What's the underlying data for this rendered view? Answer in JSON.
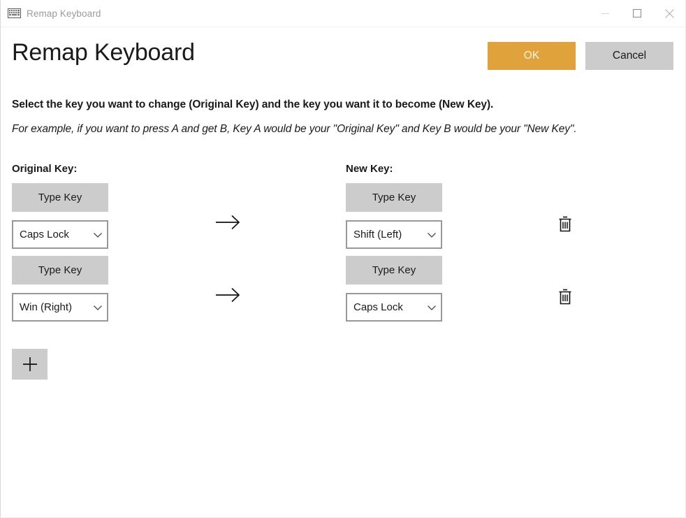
{
  "window": {
    "title": "Remap Keyboard",
    "icon": "keyboard-icon",
    "controls": {
      "minimize": "minimize-icon",
      "maximize": "maximize-icon",
      "close": "close-icon"
    }
  },
  "header": {
    "page_title": "Remap Keyboard",
    "ok_label": "OK",
    "cancel_label": "Cancel",
    "ok_color": "#e0a33c",
    "cancel_color": "#cccccc"
  },
  "description": {
    "primary": "Select the key you want to change (Original Key) and the key you want it to become (New Key).",
    "example": "For example, if you want to press A and get B, Key A would be your \"Original Key\" and Key B would be your \"New Key\"."
  },
  "table": {
    "columns": {
      "original": "Original Key:",
      "new": "New Key:"
    },
    "type_key_label": "Type Key",
    "rows": [
      {
        "original_key": "Caps Lock",
        "new_key": "Shift (Left)",
        "arrow": "arrow-right-icon",
        "delete": "delete-icon"
      },
      {
        "original_key": "Win (Right)",
        "new_key": "Caps Lock",
        "arrow": "arrow-right-icon",
        "delete": "delete-icon"
      }
    ],
    "add_label": "add-icon"
  }
}
